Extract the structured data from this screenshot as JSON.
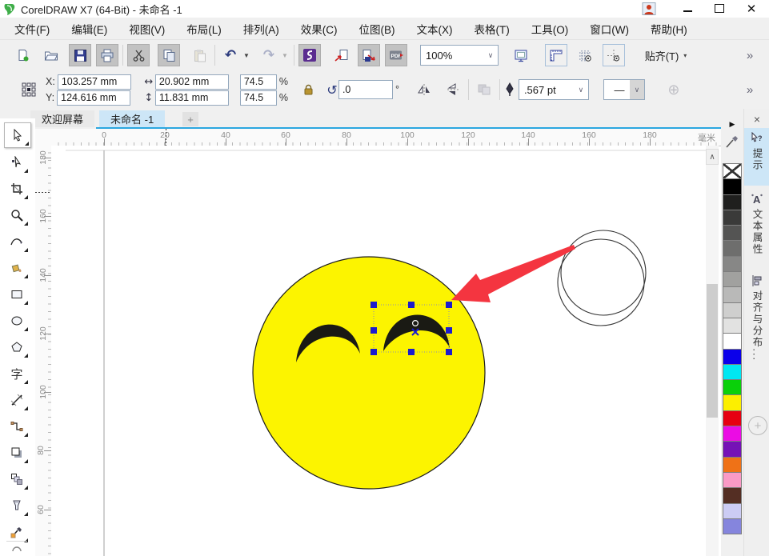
{
  "window": {
    "title": "CorelDRAW X7 (64-Bit) - 未命名 -1"
  },
  "menus": [
    {
      "label": "文件(F)"
    },
    {
      "label": "编辑(E)"
    },
    {
      "label": "视图(V)"
    },
    {
      "label": "布局(L)"
    },
    {
      "label": "排列(A)"
    },
    {
      "label": "效果(C)"
    },
    {
      "label": "位图(B)"
    },
    {
      "label": "文本(X)"
    },
    {
      "label": "表格(T)"
    },
    {
      "label": "工具(O)"
    },
    {
      "label": "窗口(W)"
    },
    {
      "label": "帮助(H)"
    }
  ],
  "toolbar": {
    "zoom_level": "100%",
    "snap_label": "贴齐(T)",
    "snap_caret": "▾",
    "overflow": "»"
  },
  "property_bar": {
    "x_label": "X:",
    "y_label": "Y:",
    "x_value": "103.257 mm",
    "y_value": "124.616 mm",
    "width_icon": "↔",
    "height_icon": "↕",
    "width_value": "20.902 mm",
    "height_value": "11.831 mm",
    "scale_h": "74.5",
    "scale_v": "74.5",
    "percent_h": "%",
    "percent_v": "%",
    "rotate_icon": "↺",
    "angle_value": ".0",
    "degree_symbol": "°",
    "outline_width": ".567 pt",
    "line_style_glyph": "—",
    "plus_glyph": "⊕",
    "overflow": "»"
  },
  "document_tabs": {
    "tabs": [
      {
        "label": "欢迎屏幕"
      },
      {
        "label": "未命名 -1"
      }
    ],
    "new_tab_label": "+"
  },
  "rulers": {
    "unit_label": "毫米",
    "h_ticks": [
      {
        "label": "0",
        "pos": 66
      },
      {
        "label": "20",
        "pos": 142
      },
      {
        "label": "40",
        "pos": 218
      },
      {
        "label": "60",
        "pos": 293
      },
      {
        "label": "80",
        "pos": 369
      },
      {
        "label": "100",
        "pos": 445
      },
      {
        "label": "120",
        "pos": 521
      },
      {
        "label": "140",
        "pos": 596
      },
      {
        "label": "160",
        "pos": 672
      },
      {
        "label": "180",
        "pos": 748
      }
    ],
    "v_ticks": [
      {
        "label": "180",
        "pos": 15
      },
      {
        "label": "160",
        "pos": 88
      },
      {
        "label": "140",
        "pos": 162
      },
      {
        "label": "120",
        "pos": 235
      },
      {
        "label": "100",
        "pos": 308
      },
      {
        "label": "80",
        "pos": 381
      },
      {
        "label": "60",
        "pos": 455
      }
    ]
  },
  "scrollbar": {
    "up_glyph": "∧"
  },
  "palette": {
    "flyout_glyph": "▶",
    "colors": [
      "none",
      "#000000",
      "#1f1f1e",
      "#3a3a39",
      "#545453",
      "#6e6e6d",
      "#878786",
      "#a1a19f",
      "#b9b9b8",
      "#cfcfce",
      "#e2e2e1",
      "#ffffff",
      "#0b00ea",
      "#00e7f2",
      "#0ad00a",
      "#fcef00",
      "#e60011",
      "#eb0ce4",
      "#7512b6",
      "#ef7217",
      "#fa9ac6",
      "#542e23",
      "#ccccf4",
      "#8585dd"
    ]
  },
  "dockers": {
    "close_glyph": "×",
    "add_glyph": "+",
    "tabs": [
      {
        "label": "提示"
      },
      {
        "label": "文本属性"
      },
      {
        "label": "对齐与分布..."
      }
    ]
  },
  "canvas": {
    "smiley_fill": "#fcf400",
    "shape_outline": "#1c1c1c",
    "eye_fill": "#1a1a14",
    "selection_color": "#1c1ccd",
    "arrow_color": "#f43540",
    "page_edge_color": "#a0a0a0"
  }
}
